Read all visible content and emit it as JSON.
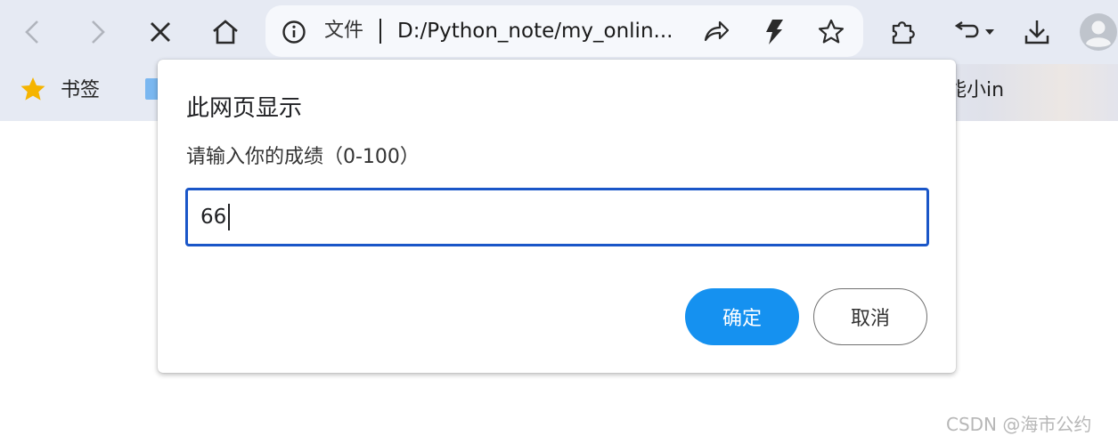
{
  "toolbar": {
    "back_icon": "chevron-left-icon",
    "forward_icon": "chevron-right-icon",
    "stop_icon": "close-icon",
    "home_icon": "home-icon",
    "omnibox": {
      "info_icon": "info-icon",
      "scheme_label": "文件",
      "url": "D:/Python_note/my_onlin...",
      "share_icon": "share-icon",
      "bolt_icon": "lightning-icon",
      "star_icon": "star-outline-icon"
    },
    "extensions_icon": "puzzle-icon",
    "undo_icon": "undo-dropdown-icon",
    "download_icon": "download-icon",
    "profile_icon": "avatar-icon"
  },
  "bookmarks": {
    "star_icon": "star-filled-icon",
    "label": "书签",
    "right_item_fragment": "能小in"
  },
  "dialog": {
    "title": "此网页显示",
    "message": "请输入你的成绩（0-100）",
    "input_value": "66",
    "ok_label": "确定",
    "cancel_label": "取消"
  },
  "colors": {
    "toolbar_bg": "#e6eaf3",
    "omnibox_bg": "#f6f8fc",
    "input_border": "#1a56c8",
    "ok_button": "#1591f0",
    "bookmark_star": "#f5b400"
  },
  "watermark": "CSDN @海市公约"
}
